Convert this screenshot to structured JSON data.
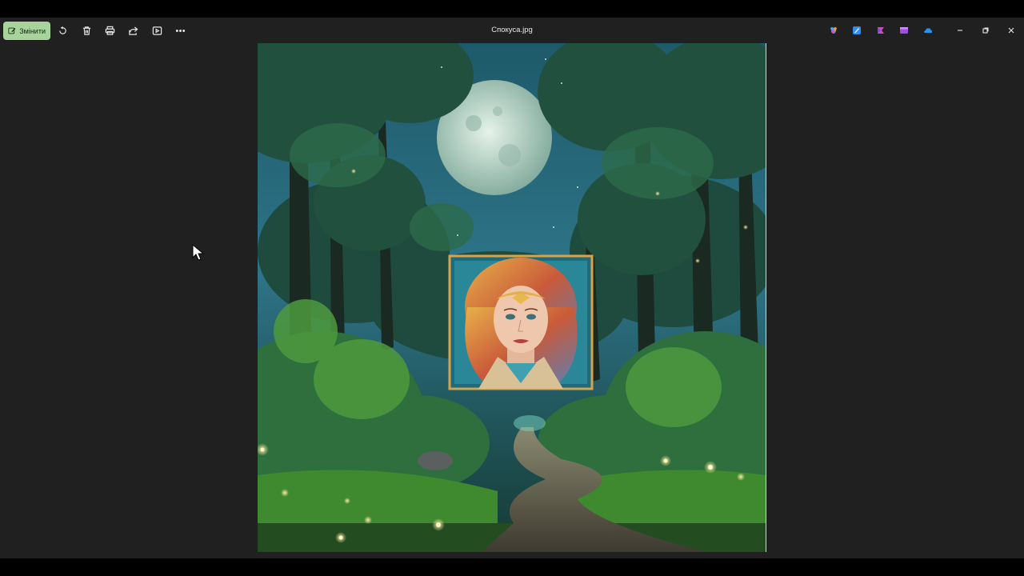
{
  "window": {
    "title": "Спокуса.jpg"
  },
  "toolbar": {
    "edit_label": "Змінити",
    "tools": [
      {
        "name": "rotate-icon"
      },
      {
        "name": "delete-icon"
      },
      {
        "name": "print-icon"
      },
      {
        "name": "share-icon"
      },
      {
        "name": "slideshow-icon"
      },
      {
        "name": "more-icon"
      }
    ],
    "apps": [
      {
        "name": "copilot-icon",
        "color": "#6a8cff"
      },
      {
        "name": "designer-icon",
        "color": "#2f8cff"
      },
      {
        "name": "clipchamp-icon",
        "color": "#d24acb"
      },
      {
        "name": "video-editor-icon",
        "color": "#a14be8"
      },
      {
        "name": "onedrive-icon",
        "color": "#2d8fe6"
      }
    ]
  },
  "colors": {
    "accent": "#a8d39a",
    "background": "#202020",
    "text": "#e8e8e8"
  }
}
